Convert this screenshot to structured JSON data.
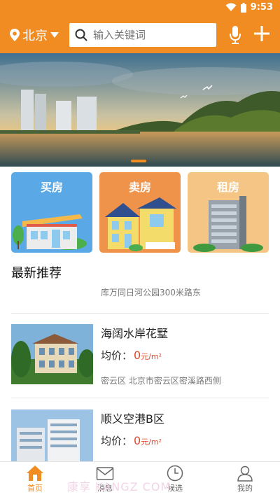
{
  "status_bar": {
    "time": "9:53",
    "icons": [
      "wifi-icon",
      "battery-icon"
    ]
  },
  "header": {
    "city": "北京",
    "search_placeholder": "输入关键词",
    "icons": [
      "location-pin-icon",
      "dropdown-arrow-icon",
      "search-icon",
      "microphone-icon",
      "plus-icon"
    ]
  },
  "banner": {
    "page_indicator_active": 1
  },
  "categories": [
    {
      "label": "买房",
      "color": "#5aa9e6"
    },
    {
      "label": "卖房",
      "color": "#f0934a"
    },
    {
      "label": "租房",
      "color": "#f4c585"
    }
  ],
  "recommend": {
    "title": "最新推荐",
    "clipped_address": "库万同日河公园300米路东",
    "listings": [
      {
        "name": "海阔水岸花墅",
        "price_label": "均价：",
        "price_value": "0",
        "price_unit": "元/m²",
        "address": "密云区 北京市密云区密溪路西侧"
      },
      {
        "name": "顺义空港B区",
        "price_label": "均价：",
        "price_value": "0",
        "price_unit": "元/m²",
        "address": ""
      }
    ]
  },
  "bottom_nav": {
    "items": [
      {
        "label": "首页",
        "icon": "home-icon",
        "active": true
      },
      {
        "label": "消息",
        "icon": "message-icon",
        "active": false
      },
      {
        "label": "候选",
        "icon": "clock-icon",
        "active": false
      },
      {
        "label": "我的",
        "icon": "user-icon",
        "active": false
      }
    ],
    "watermark": "康享  KANGZ  COM"
  },
  "colors": {
    "accent": "#f08c22",
    "price": "#e0492d"
  }
}
